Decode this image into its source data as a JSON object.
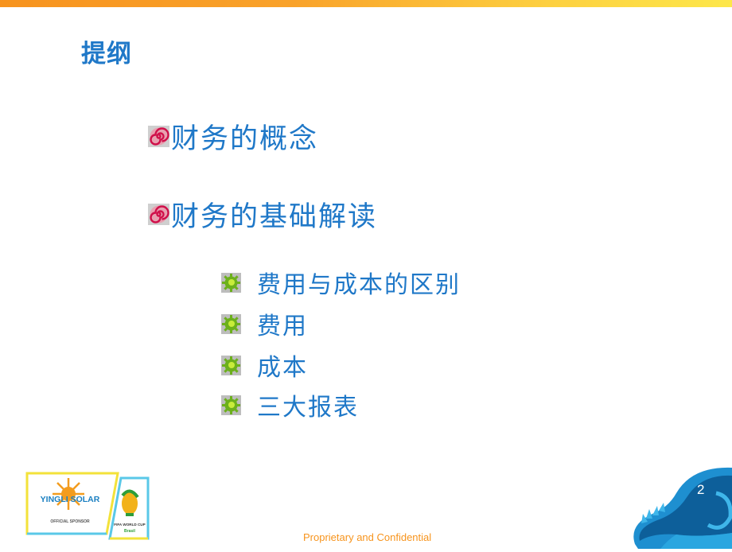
{
  "slide": {
    "title": "提纲",
    "level1_items": [
      {
        "label": "财务的概念",
        "bullet_icon": "red-spiral-icon"
      },
      {
        "label": "财务的基础解读",
        "bullet_icon": "red-spiral-icon"
      }
    ],
    "level2_items": [
      {
        "label": "费用与成本的区别",
        "bullet_icon": "green-gear-icon"
      },
      {
        "label": "费用",
        "bullet_icon": "green-gear-icon"
      },
      {
        "label": "成本",
        "bullet_icon": "green-gear-icon"
      },
      {
        "label": "三大报表",
        "bullet_icon": "green-gear-icon"
      }
    ],
    "page_number": "2",
    "footer": "Proprietary and Confidential",
    "logo": {
      "brand": "YINGLI SOLAR",
      "tagline": "OFFICIAL SPONSOR",
      "event": "FIFA WORLD CUP",
      "event_sub": "Brasil"
    },
    "colors": {
      "text_blue": "#1f78c8",
      "footer_orange": "#f7941d",
      "bar_start": "#f7931e",
      "bar_end": "#fde74a"
    }
  }
}
